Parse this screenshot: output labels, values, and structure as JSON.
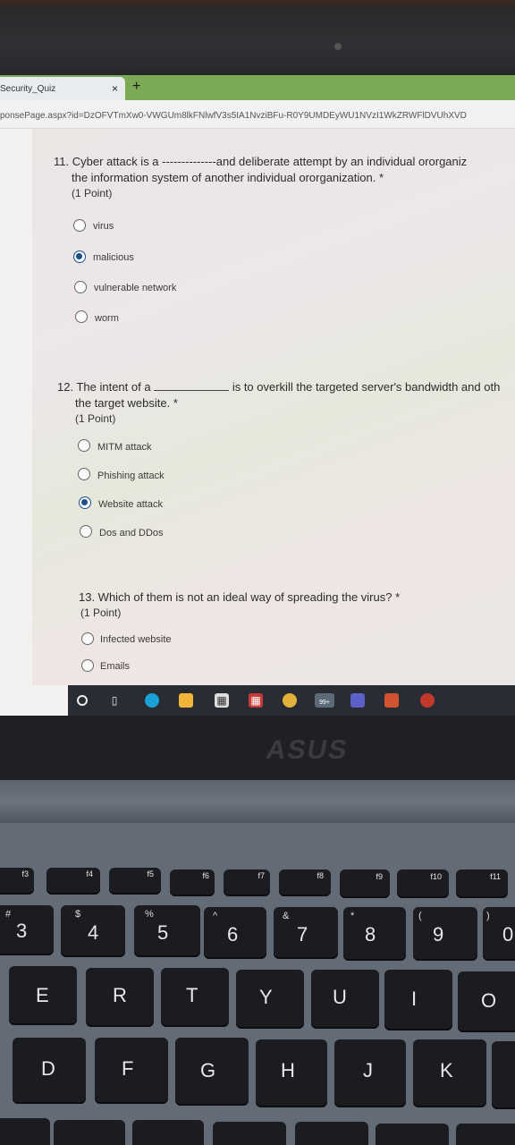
{
  "browser": {
    "tab_title": "Security_Quiz",
    "tab_close": "×",
    "new_tab": "+",
    "url": "ponsePage.aspx?id=DzOFVTmXw0-VWGUm8lkFNlwfV3s5IA1NvziBFu-R0Y9UMDEyWU1NVzI1WkZRWFlDVUhXVD"
  },
  "quiz": {
    "q11": {
      "text_line1": "11. Cyber attack is a --------------and deliberate attempt by an individual ororganiz",
      "text_line2": "the information system of another individual ororganization. *",
      "points": "(1 Point)",
      "options": [
        "virus",
        "malicious",
        "vulnerable network",
        "worm"
      ],
      "selected": "malicious"
    },
    "q12": {
      "text_prefix": "12. The intent of a",
      "text_suffix": "is to overkill the targeted server's bandwidth and oth",
      "text_line2": "the target website. *",
      "points": "(1 Point)",
      "options": [
        "MITM attack",
        "Phishing attack",
        "Website attack",
        "Dos and DDos"
      ],
      "selected": "Website attack"
    },
    "q13": {
      "text_line1": "13. Which of them is not an ideal way of spreading the virus? *",
      "points": "(1 Point)",
      "options": [
        "Infected website",
        "Emails"
      ]
    }
  },
  "taskbar": {
    "icons": [
      "search-icon",
      "task-view-icon",
      "edge-icon",
      "file-explorer-icon",
      "store-icon",
      "gift-icon",
      "chrome-icon",
      "mail-icon",
      "teams-icon",
      "powerpoint-icon",
      "app-icon"
    ],
    "mail_badge": "99+"
  },
  "laptop": {
    "logo": "ASUS"
  },
  "keyboard": {
    "fkeys": [
      {
        "label": "f3"
      },
      {
        "label": "f4"
      },
      {
        "label": "f5"
      },
      {
        "label": "f6"
      },
      {
        "label": "f7"
      },
      {
        "label": "f8"
      },
      {
        "label": "f9"
      },
      {
        "label": "f10"
      },
      {
        "label": "f11"
      }
    ],
    "number_row": [
      {
        "main": "3",
        "sub": "#"
      },
      {
        "main": "4",
        "sub": "$"
      },
      {
        "main": "5",
        "sub": "%"
      },
      {
        "main": "6",
        "sub": "^"
      },
      {
        "main": "7",
        "sub": "&"
      },
      {
        "main": "8",
        "sub": "*"
      },
      {
        "main": "9",
        "sub": "("
      },
      {
        "main": "0",
        "sub": ")"
      }
    ],
    "row_e": [
      "E",
      "R",
      "T",
      "Y",
      "U",
      "I",
      "O"
    ],
    "row_d": [
      "D",
      "F",
      "G",
      "H",
      "J",
      "K"
    ]
  }
}
